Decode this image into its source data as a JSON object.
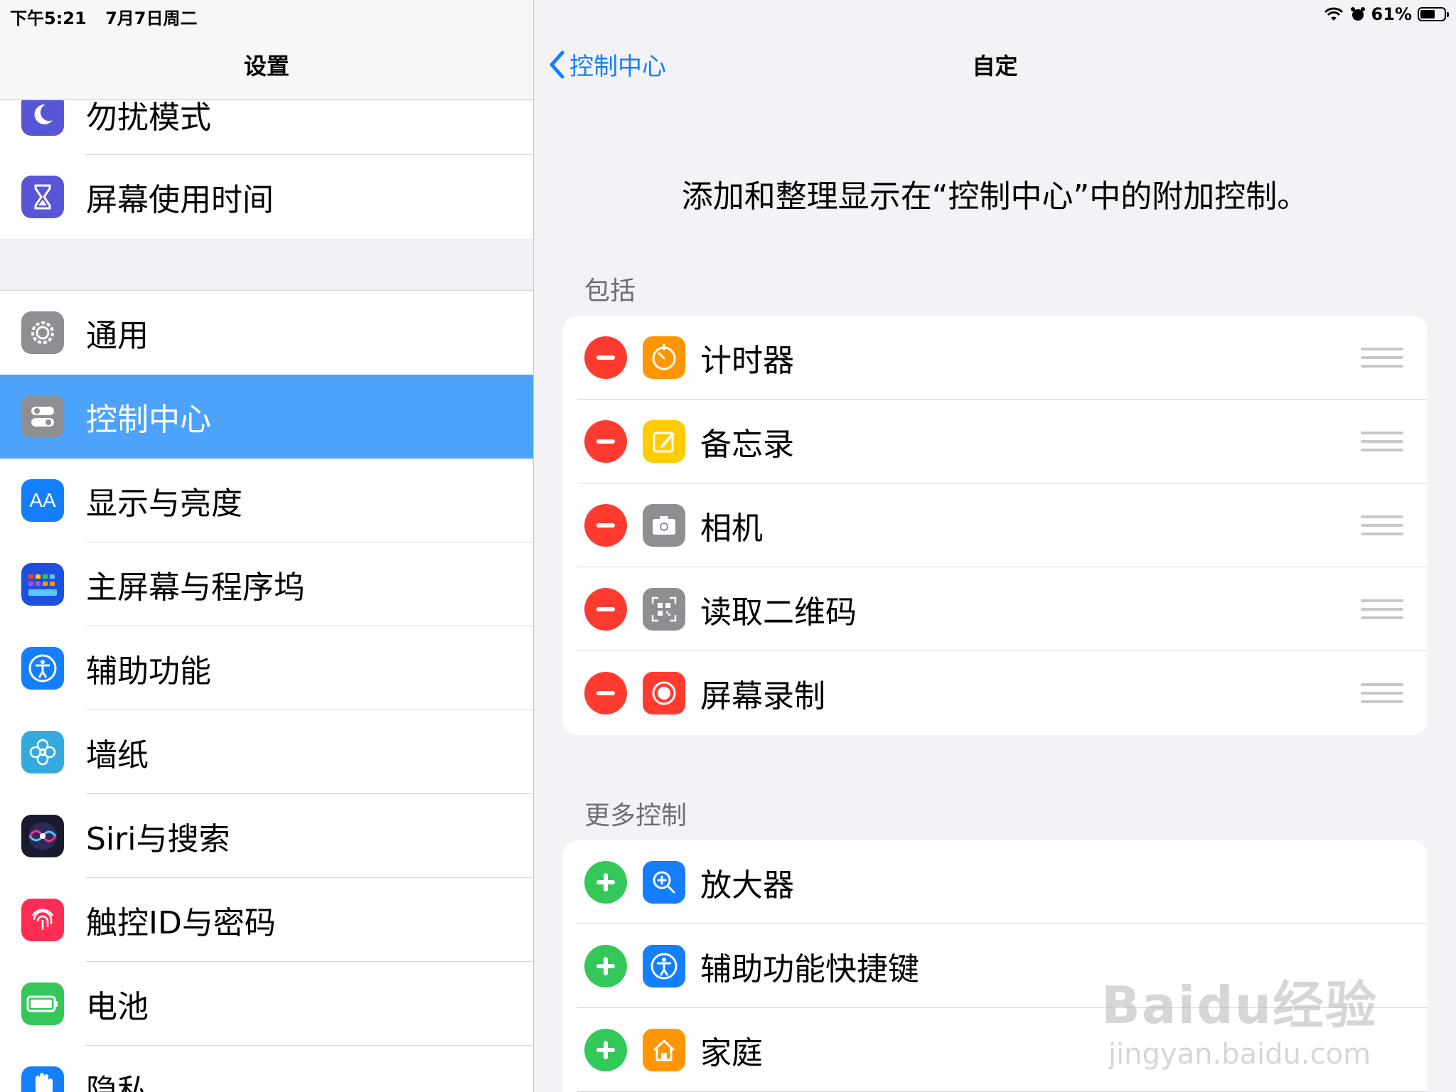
{
  "status": {
    "time": "下午5:21",
    "date": "7月7日周二",
    "battery": "61%",
    "battery_fraction": 0.61
  },
  "sidebar": {
    "title": "设置",
    "group1": [
      {
        "label": "勿扰模式",
        "icon": "moon-icon",
        "color": "#5856d6"
      },
      {
        "label": "屏幕使用时间",
        "icon": "hourglass-icon",
        "color": "#5856d6"
      }
    ],
    "group2": [
      {
        "label": "通用",
        "icon": "gear-icon",
        "color": "#8e8e93"
      },
      {
        "label": "控制中心",
        "icon": "toggles-icon",
        "color": "#8e8e93",
        "selected": true
      },
      {
        "label": "显示与亮度",
        "icon": "text-size-icon",
        "color": "#147efb",
        "glyph": "AA"
      },
      {
        "label": "主屏幕与程序坞",
        "icon": "home-grid-icon",
        "color": "#1e50e0"
      },
      {
        "label": "辅助功能",
        "icon": "accessibility-icon",
        "color": "#147efb"
      },
      {
        "label": "墙纸",
        "icon": "flower-icon",
        "color": "#34aadc"
      },
      {
        "label": "Siri与搜索",
        "icon": "siri-icon",
        "color": "#1a1a2e"
      },
      {
        "label": "触控ID与密码",
        "icon": "fingerprint-icon",
        "color": "#ff2d55"
      },
      {
        "label": "电池",
        "icon": "battery-icon",
        "color": "#34c759"
      },
      {
        "label": "隐私",
        "icon": "hand-icon",
        "color": "#147efb"
      }
    ]
  },
  "detail": {
    "back_label": "控制中心",
    "title": "自定",
    "description": "添加和整理显示在“控制中心”中的附加控制。",
    "included_header": "包括",
    "included": [
      {
        "label": "计时器",
        "icon": "timer-icon",
        "color": "#ff9500"
      },
      {
        "label": "备忘录",
        "icon": "notes-icon",
        "color": "#ffcc00"
      },
      {
        "label": "相机",
        "icon": "camera-icon",
        "color": "#8e8e93"
      },
      {
        "label": "读取二维码",
        "icon": "qr-code-icon",
        "color": "#8e8e93"
      },
      {
        "label": "屏幕录制",
        "icon": "screen-record-icon",
        "color": "#ff3b30"
      }
    ],
    "more_header": "更多控制",
    "more": [
      {
        "label": "放大器",
        "icon": "magnifier-icon",
        "color": "#147efb"
      },
      {
        "label": "辅助功能快捷键",
        "icon": "accessibility-icon",
        "color": "#147efb"
      },
      {
        "label": "家庭",
        "icon": "home-icon",
        "color": "#ff9500"
      }
    ]
  },
  "watermark": {
    "brand": "Baidu经验",
    "url": "jingyan.baidu.com"
  }
}
